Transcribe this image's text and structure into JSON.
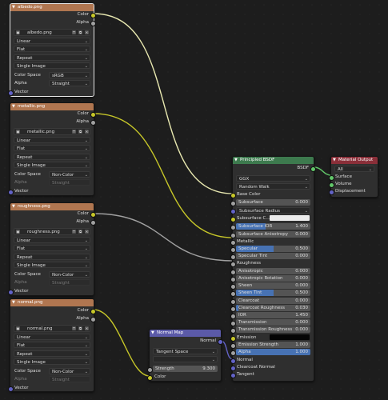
{
  "nodes": {
    "albedo": {
      "title": "albedo.png",
      "out_color": "Color",
      "out_alpha": "Alpha",
      "image": "albedo.png",
      "interpolation": "Linear",
      "projection": "Flat",
      "extension": "Repeat",
      "source": "Single Image",
      "color_space_label": "Color Space",
      "color_space": "sRGB",
      "alpha_label": "Alpha",
      "alpha_mode": "Straight",
      "in_vector": "Vector"
    },
    "metallic": {
      "title": "metallic.png",
      "out_color": "Color",
      "out_alpha": "Alpha",
      "image": "metallic.png",
      "interpolation": "Linear",
      "projection": "Flat",
      "extension": "Repeat",
      "source": "Single Image",
      "color_space_label": "Color Space",
      "color_space": "Non-Color",
      "alpha_label": "Alpha",
      "alpha_mode": "Straight",
      "in_vector": "Vector"
    },
    "roughness": {
      "title": "roughness.png",
      "out_color": "Color",
      "out_alpha": "Alpha",
      "image": "roughness.png",
      "interpolation": "Linear",
      "projection": "Flat",
      "extension": "Repeat",
      "source": "Single Image",
      "color_space_label": "Color Space",
      "color_space": "Non-Color",
      "alpha_label": "Alpha",
      "alpha_mode": "Straight",
      "in_vector": "Vector"
    },
    "normal": {
      "title": "normal.png",
      "out_color": "Color",
      "out_alpha": "Alpha",
      "image": "normal.png",
      "interpolation": "Linear",
      "projection": "Flat",
      "extension": "Repeat",
      "source": "Single Image",
      "color_space_label": "Color Space",
      "color_space": "Non-Color",
      "alpha_label": "Alpha",
      "alpha_mode": "Straight",
      "in_vector": "Vector"
    },
    "normal_map": {
      "title": "Normal Map",
      "out_normal": "Normal",
      "space": "Tangent Space",
      "strength_label": "Strength",
      "strength": "9.300",
      "in_color": "Color"
    },
    "bsdf": {
      "title": "Principled BSDF",
      "out_bsdf": "BSDF",
      "distribution": "GGX",
      "subsurface_method": "Random Walk",
      "base_color": "Base Color",
      "subsurface": {
        "label": "Subsurface",
        "value": "0.000"
      },
      "subsurface_radius": "Subsurface Radius",
      "subsurface_color": "Subsurface C...",
      "subsurface_ior": {
        "label": "Subsurface IOR",
        "value": "1.400"
      },
      "subsurface_anisotropy": {
        "label": "Subsurface Anisotropy",
        "value": "0.000"
      },
      "metallic": "Metallic",
      "specular": {
        "label": "Specular",
        "value": "0.500",
        "fill": 0.5
      },
      "specular_tint": {
        "label": "Specular Tint",
        "value": "0.000"
      },
      "roughness": "Roughness",
      "anisotropic": {
        "label": "Anisotropic",
        "value": "0.000"
      },
      "anisotropic_rotation": {
        "label": "Anisotropic Rotation",
        "value": "0.000"
      },
      "sheen": {
        "label": "Sheen",
        "value": "0.000"
      },
      "sheen_tint": {
        "label": "Sheen Tint",
        "value": "0.500",
        "fill": 0.5
      },
      "clearcoat": {
        "label": "Clearcoat",
        "value": "0.000"
      },
      "clearcoat_roughness": {
        "label": "Clearcoat Roughness",
        "value": "0.030"
      },
      "ior": {
        "label": "IOR",
        "value": "1.450"
      },
      "transmission": {
        "label": "Transmission",
        "value": "0.000"
      },
      "transmission_roughness": {
        "label": "Transmission Roughness",
        "value": "0.000"
      },
      "emission": "Emission",
      "emission_strength": {
        "label": "Emission Strength",
        "value": "1.000"
      },
      "alpha": {
        "label": "Alpha",
        "value": "1.000",
        "fill": 1.0
      },
      "normal": "Normal",
      "clearcoat_normal": "Clearcoat Normal",
      "tangent": "Tangent"
    },
    "material_output": {
      "title": "Material Output",
      "target": "All",
      "surface": "Surface",
      "volume": "Volume",
      "displacement": "Displacement"
    }
  },
  "colors": {
    "texture_header": "#b07650",
    "vector_header": "#5b5aa8",
    "shader_header": "#3d7a4e",
    "output_header": "#8a2f39",
    "socket_color": "#c7c729",
    "socket_float": "#a1a1a1",
    "socket_vector": "#6363c7",
    "socket_shader": "#62c76a",
    "slider_fill": "#4772b3"
  }
}
